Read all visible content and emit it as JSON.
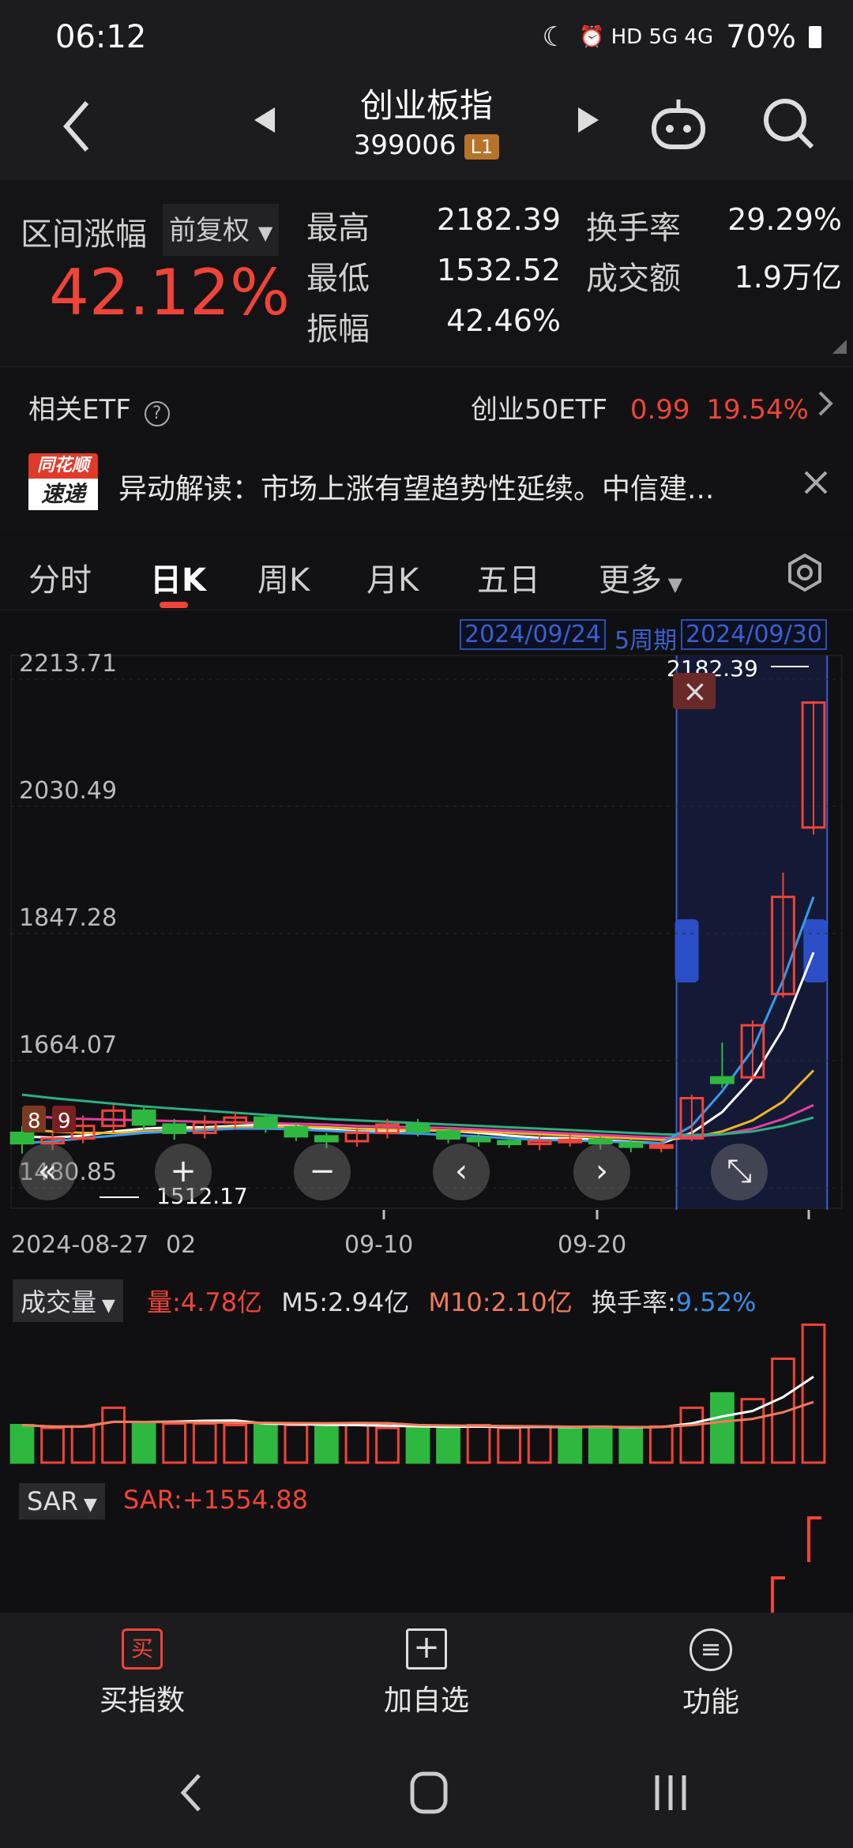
{
  "status": {
    "time": "06:12",
    "icons": "⏰ HD 5G 4G",
    "battery": "70%"
  },
  "header": {
    "title": "创业板指",
    "code": "399006",
    "level": "L1"
  },
  "stats": {
    "range_label": "区间涨幅",
    "adjust": "前复权",
    "change_pct": "42.12%",
    "high_label": "最高",
    "high": "2182.39",
    "low_label": "最低",
    "low": "1532.52",
    "amp_label": "振幅",
    "amp": "42.46%",
    "turnover_label": "换手率",
    "turnover": "29.29%",
    "amount_label": "成交额",
    "amount": "1.9万亿"
  },
  "etf": {
    "label": "相关ETF",
    "name": "创业50ETF",
    "price": "0.99",
    "pct": "19.54%"
  },
  "news": {
    "logo_top": "同花顺",
    "logo_bottom": "速递",
    "text": "异动解读：市场上涨有望趋势性延续。中信建..."
  },
  "tabs": [
    "分时",
    "日K",
    "周K",
    "月K",
    "五日",
    "更多"
  ],
  "chart_data": {
    "type": "candlestick",
    "y_ticks": [
      "2213.71",
      "2030.49",
      "1847.28",
      "1664.07",
      "1480.85"
    ],
    "x_labels": [
      "2024-08-27",
      "02",
      "09-10",
      "09-20"
    ],
    "range_start": "2024/09/24",
    "range_period": "5周期",
    "range_end": "2024/09/30",
    "max_label": "2182.39",
    "min_label": "1512.17",
    "ma_badges": [
      "8",
      "9"
    ],
    "candles": [
      {
        "o": 1560,
        "c": 1545,
        "h": 1570,
        "l": 1530
      },
      {
        "o": 1545,
        "c": 1552,
        "h": 1560,
        "l": 1535
      },
      {
        "o": 1552,
        "c": 1570,
        "h": 1585,
        "l": 1545
      },
      {
        "o": 1570,
        "c": 1592,
        "h": 1600,
        "l": 1560
      },
      {
        "o": 1592,
        "c": 1572,
        "h": 1598,
        "l": 1565
      },
      {
        "o": 1572,
        "c": 1560,
        "h": 1580,
        "l": 1550
      },
      {
        "o": 1560,
        "c": 1575,
        "h": 1585,
        "l": 1552
      },
      {
        "o": 1575,
        "c": 1582,
        "h": 1590,
        "l": 1565
      },
      {
        "o": 1582,
        "c": 1568,
        "h": 1588,
        "l": 1560
      },
      {
        "o": 1568,
        "c": 1555,
        "h": 1575,
        "l": 1548
      },
      {
        "o": 1555,
        "c": 1548,
        "h": 1560,
        "l": 1538
      },
      {
        "o": 1548,
        "c": 1560,
        "h": 1566,
        "l": 1540
      },
      {
        "o": 1560,
        "c": 1572,
        "h": 1580,
        "l": 1552
      },
      {
        "o": 1572,
        "c": 1562,
        "h": 1580,
        "l": 1555
      },
      {
        "o": 1562,
        "c": 1552,
        "h": 1568,
        "l": 1545
      },
      {
        "o": 1552,
        "c": 1548,
        "h": 1558,
        "l": 1540
      },
      {
        "o": 1548,
        "c": 1544,
        "h": 1552,
        "l": 1538
      },
      {
        "o": 1544,
        "c": 1548,
        "h": 1556,
        "l": 1535
      },
      {
        "o": 1548,
        "c": 1550,
        "h": 1560,
        "l": 1540
      },
      {
        "o": 1550,
        "c": 1545,
        "h": 1555,
        "l": 1536
      },
      {
        "o": 1545,
        "c": 1540,
        "h": 1550,
        "l": 1532
      },
      {
        "o": 1540,
        "c": 1542,
        "h": 1548,
        "l": 1532
      },
      {
        "o": 1552,
        "c": 1610,
        "h": 1615,
        "l": 1548
      },
      {
        "o": 1640,
        "c": 1632,
        "h": 1690,
        "l": 1625
      },
      {
        "o": 1640,
        "c": 1715,
        "h": 1722,
        "l": 1635
      },
      {
        "o": 1760,
        "c": 1900,
        "h": 1935,
        "l": 1755
      },
      {
        "o": 2000,
        "c": 2180,
        "h": 2182,
        "l": 1990
      }
    ],
    "ma_series": [
      {
        "color": "#ffffff",
        "values": [
          1555,
          1553,
          1556,
          1562,
          1566,
          1568,
          1568,
          1570,
          1572,
          1570,
          1565,
          1562,
          1562,
          1564,
          1563,
          1560,
          1556,
          1553,
          1552,
          1550,
          1547,
          1545,
          1560,
          1590,
          1638,
          1710,
          1820
        ]
      },
      {
        "color": "#f0b429",
        "values": [
          1565,
          1562,
          1560,
          1560,
          1562,
          1564,
          1566,
          1568,
          1569,
          1569,
          1568,
          1566,
          1565,
          1564,
          1563,
          1562,
          1560,
          1558,
          1556,
          1554,
          1552,
          1550,
          1553,
          1562,
          1578,
          1605,
          1650
        ]
      },
      {
        "color": "#e040a0",
        "values": [
          1585,
          1582,
          1580,
          1579,
          1578,
          1577,
          1576,
          1575,
          1574,
          1573,
          1572,
          1570,
          1569,
          1568,
          1567,
          1565,
          1563,
          1561,
          1559,
          1557,
          1555,
          1553,
          1554,
          1558,
          1566,
          1580,
          1600
        ]
      },
      {
        "color": "#2fae82",
        "values": [
          1615,
          1610,
          1606,
          1602,
          1598,
          1595,
          1592,
          1589,
          1586,
          1583,
          1580,
          1578,
          1576,
          1574,
          1572,
          1570,
          1568,
          1566,
          1564,
          1562,
          1560,
          1558,
          1557,
          1558,
          1562,
          1570,
          1582
        ]
      },
      {
        "color": "#3a9be8",
        "values": [
          1545,
          1548,
          1552,
          1556,
          1560,
          1562,
          1564,
          1566,
          1566,
          1565,
          1563,
          1561,
          1560,
          1559,
          1557,
          1555,
          1552,
          1550,
          1549,
          1548,
          1546,
          1545,
          1570,
          1620,
          1680,
          1780,
          1900
        ]
      }
    ],
    "volume": {
      "label": "成交量",
      "current_label": "量:",
      "current": "4.78亿",
      "m5_label": "M5:",
      "m5": "2.94亿",
      "m10_label": "M10:",
      "m10": "2.10亿",
      "turnover_label": "换手率:",
      "turnover": "9.52%",
      "values": [
        1.3,
        1.2,
        1.25,
        1.9,
        1.4,
        1.35,
        1.35,
        1.3,
        1.35,
        1.3,
        1.25,
        1.3,
        1.2,
        1.25,
        1.2,
        1.3,
        1.2,
        1.25,
        1.2,
        1.25,
        1.2,
        1.25,
        1.9,
        2.4,
        2.2,
        3.6,
        4.78
      ],
      "up": [
        false,
        true,
        true,
        true,
        false,
        true,
        true,
        true,
        false,
        true,
        false,
        true,
        true,
        false,
        false,
        true,
        true,
        true,
        false,
        false,
        false,
        true,
        true,
        false,
        true,
        true,
        true
      ]
    },
    "sar": {
      "label": "SAR",
      "value_label": "SAR:",
      "value": "+1554.88"
    }
  },
  "bottom_bar": [
    {
      "icon": "买",
      "label": "买指数"
    },
    {
      "icon": "+",
      "label": "加自选"
    },
    {
      "icon": "≡",
      "label": "功能"
    }
  ],
  "colors": {
    "up": "#f04438",
    "down": "#2eb840",
    "bg": "#101012"
  }
}
